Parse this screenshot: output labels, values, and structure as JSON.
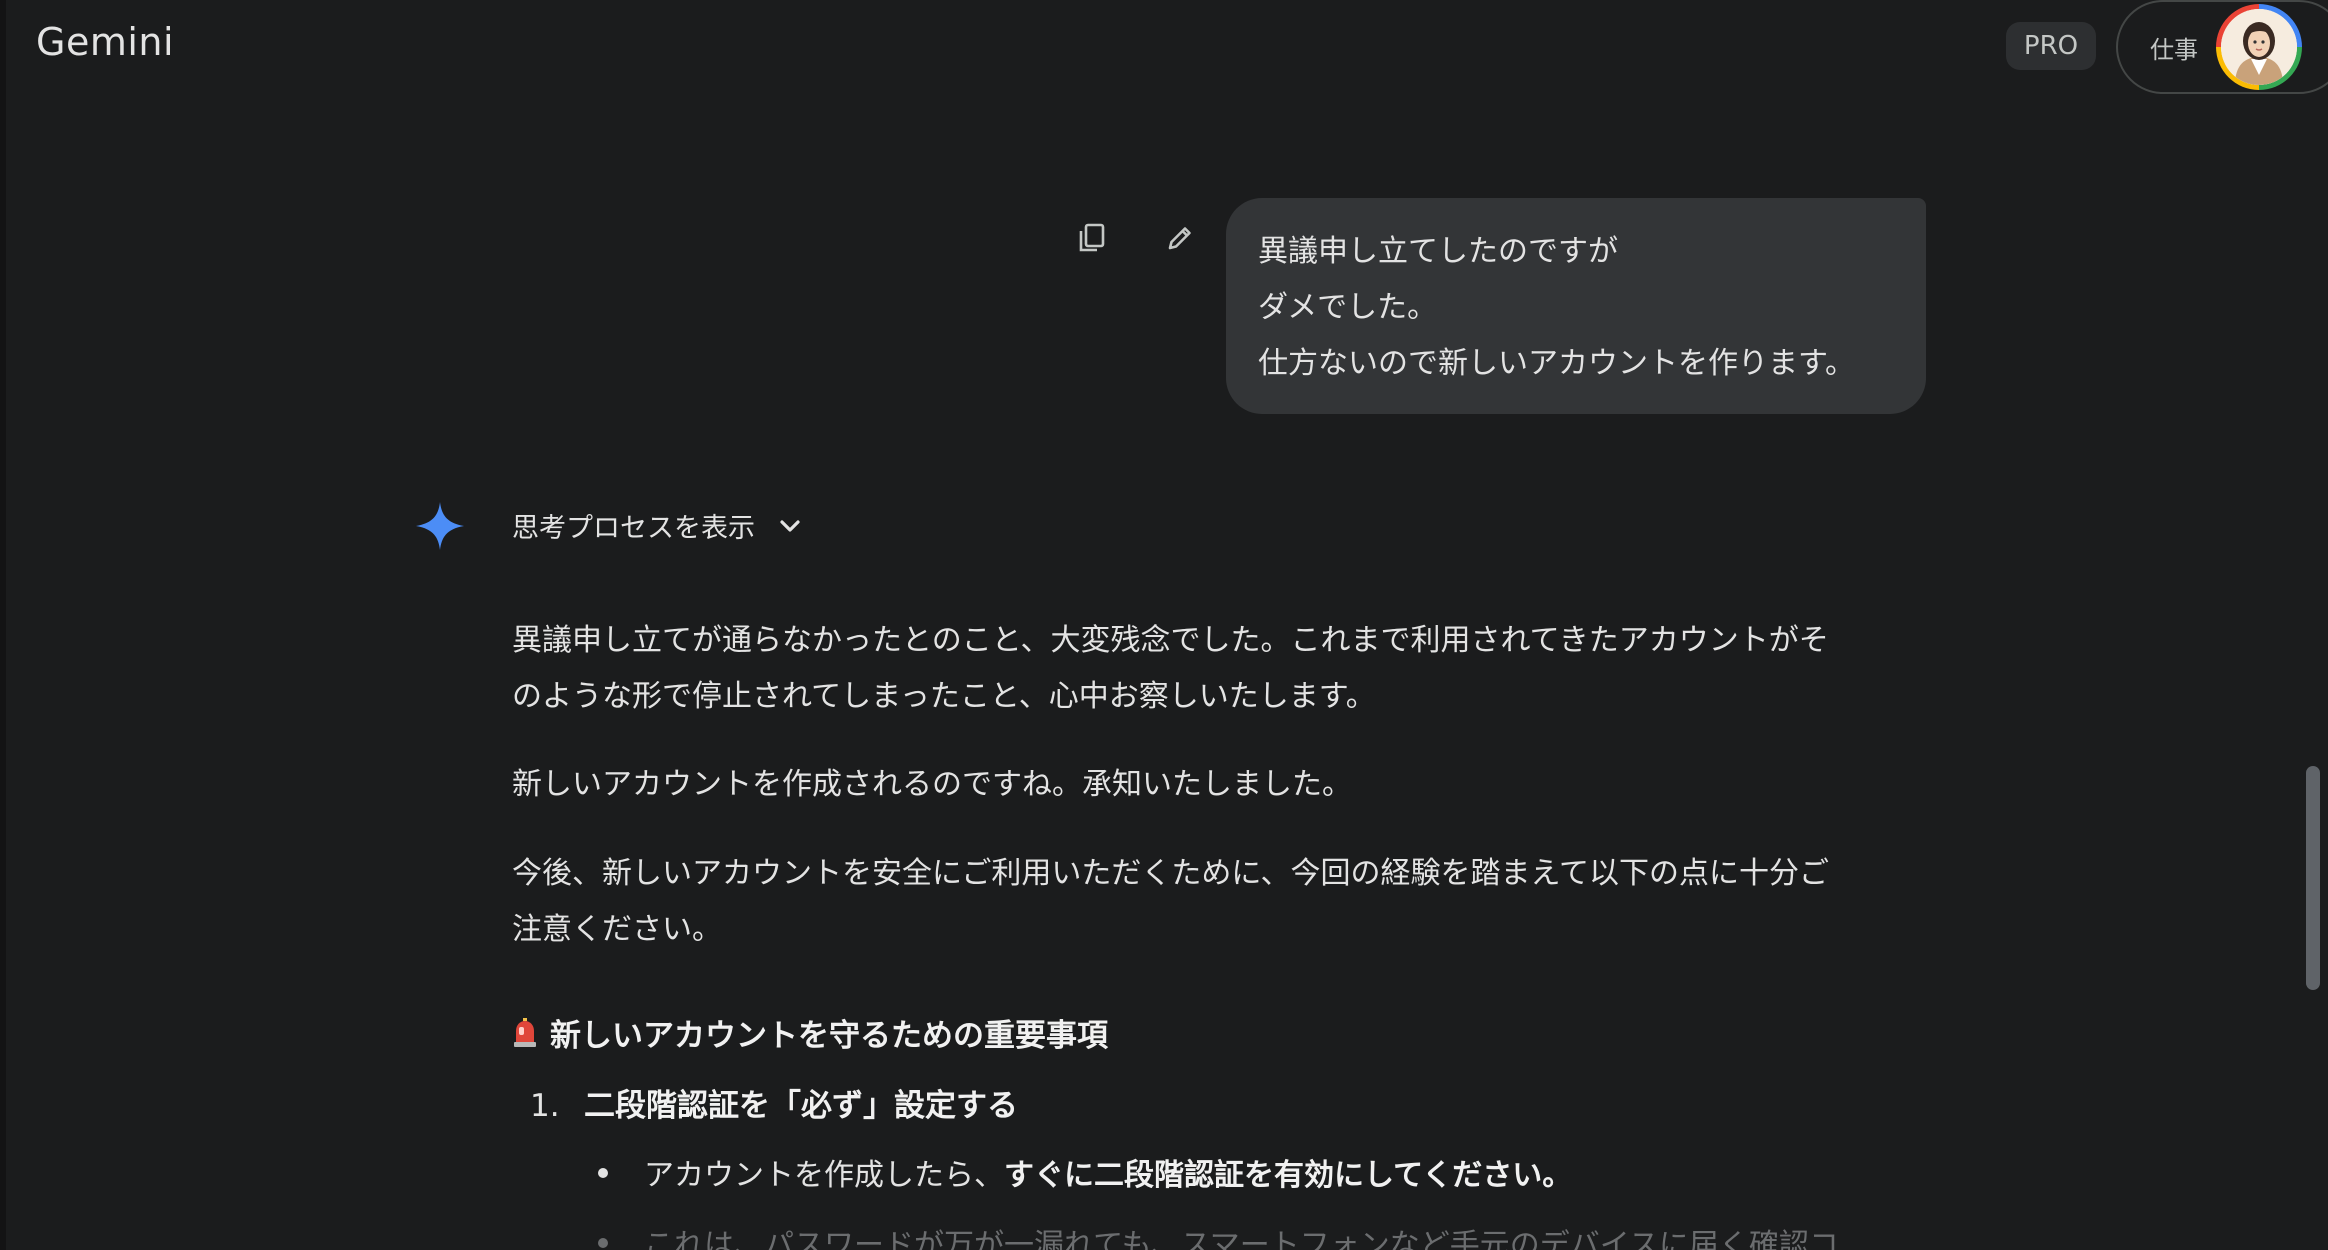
{
  "header": {
    "app_title": "Gemini",
    "plan_badge": "PRO",
    "account_label": "仕事"
  },
  "user_message": {
    "lines": [
      "異議申し立てしたのですが",
      "ダメでした。",
      "仕方ないので新しいアカウントを作ります。"
    ],
    "actions": [
      "copy-icon",
      "edit-icon"
    ]
  },
  "response": {
    "thinking_toggle": "思考プロセスを表示",
    "paragraphs": [
      [
        "異議申し立てが通らなかったとのこと、大変残念でした。これまで利用されてきたアカウントがそ",
        "のような形で停止されてしまったこと、心中お察しいたします。"
      ],
      [
        "新しいアカウントを作成されるのですね。承知いたしました。"
      ],
      [
        "今後、新しいアカウントを安全にご利用いただくために、今回の経験を踏まえて以下の点に十分ご",
        "注意ください。"
      ]
    ],
    "section_heading": "新しいアカウントを守るための重要事項",
    "list_items": [
      {
        "number": "1.",
        "title": "二段階認証を「必ず」設定する",
        "bullets": [
          {
            "prefix": "アカウントを作成したら、",
            "strong": "すぐに二段階認証を有効にしてください。"
          },
          {
            "prefix": "これは、パスワードが万が一漏れても、スマートフォンなど手元のデバイスに届く確認コ",
            "strong": ""
          }
        ]
      }
    ]
  },
  "colors": {
    "background": "#1b1c1d",
    "bubble": "#333537",
    "star": "#4c8df6",
    "text": "#e3e3e3"
  }
}
